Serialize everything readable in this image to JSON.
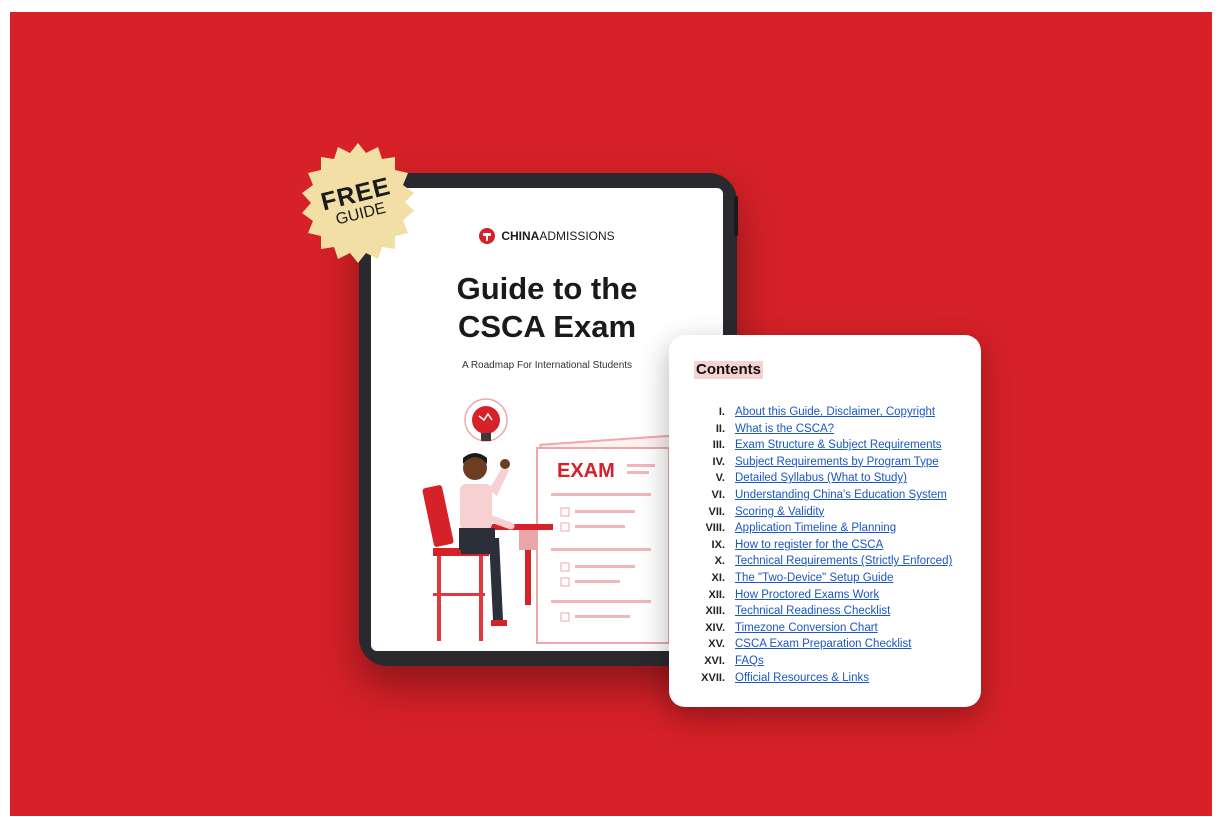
{
  "brand": {
    "strong": "CHINA",
    "rest": "ADMISSIONS"
  },
  "cover": {
    "title_line1": "Guide to the",
    "title_line2": "CSCA Exam",
    "subtitle": "A Roadmap For International Students",
    "exam_sheet_label": "EXAM"
  },
  "badge": {
    "line1": "FREE",
    "line2": "GUIDE"
  },
  "contents": {
    "heading": "Contents",
    "items": [
      {
        "num": "I.",
        "label": "About this Guide, Disclaimer, Copyright"
      },
      {
        "num": "II.",
        "label": "What is the CSCA?"
      },
      {
        "num": "III.",
        "label": "Exam Structure & Subject Requirements"
      },
      {
        "num": "IV.",
        "label": "Subject Requirements by Program Type"
      },
      {
        "num": "V.",
        "label": "Detailed Syllabus (What to Study)"
      },
      {
        "num": "VI.",
        "label": "Understanding China's Education System"
      },
      {
        "num": "VII.",
        "label": "Scoring & Validity"
      },
      {
        "num": "VIII.",
        "label": "Application Timeline & Planning"
      },
      {
        "num": "IX.",
        "label": "How to register for the CSCA"
      },
      {
        "num": "X.",
        "label": "Technical Requirements (Strictly Enforced)"
      },
      {
        "num": "XI.",
        "label": "The \"Two-Device\" Setup Guide"
      },
      {
        "num": "XII.",
        "label": "How Proctored Exams Work"
      },
      {
        "num": "XIII.",
        "label": "Technical Readiness Checklist"
      },
      {
        "num": "XIV.",
        "label": "Timezone Conversion Chart"
      },
      {
        "num": "XV.",
        "label": "CSCA Exam Preparation Checklist"
      },
      {
        "num": "XVI.",
        "label": "FAQs"
      },
      {
        "num": "XVII.",
        "label": "Official Resources & Links"
      }
    ]
  },
  "colors": {
    "background": "#d52127",
    "badge": "#f2dfa5",
    "link": "#1a56c4",
    "heading_highlight": "#f6d3d3"
  }
}
